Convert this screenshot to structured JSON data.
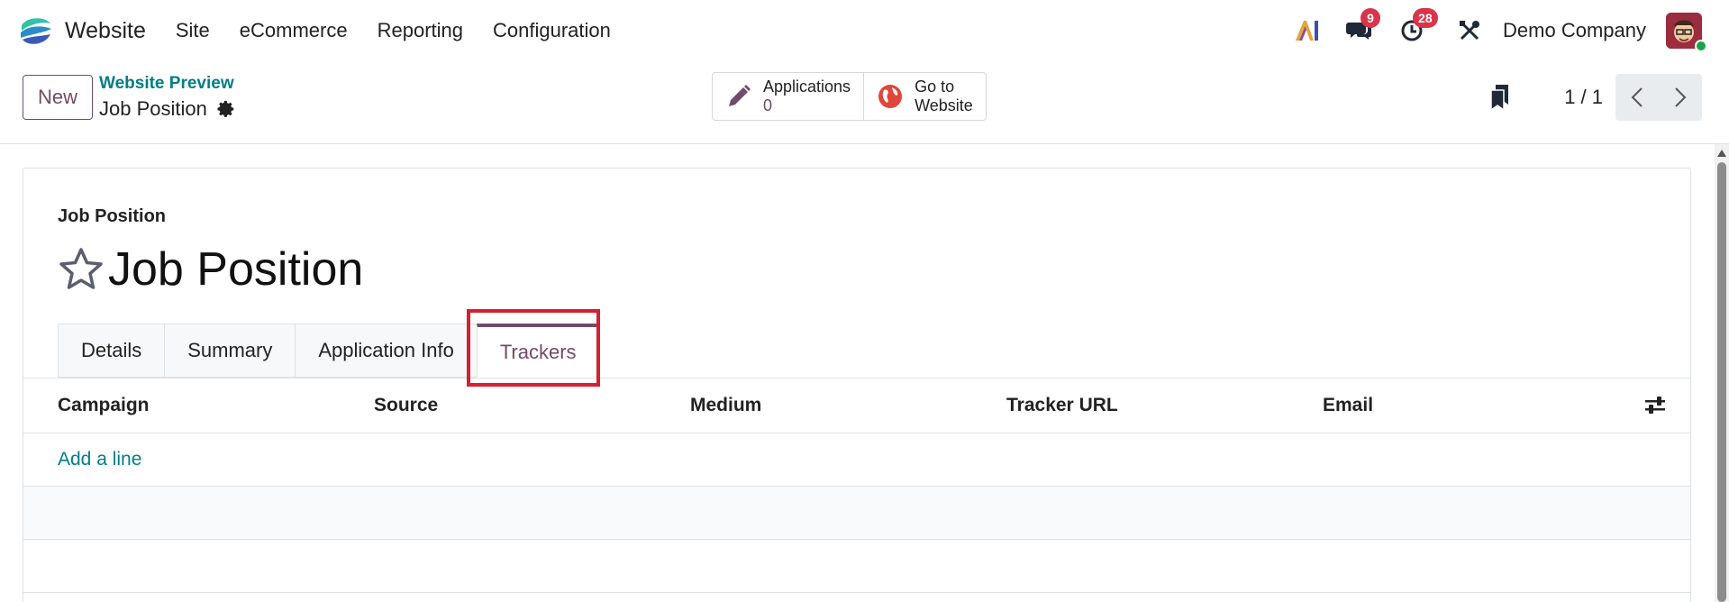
{
  "navbar": {
    "app_name": "Website",
    "menu": [
      "Site",
      "eCommerce",
      "Reporting",
      "Configuration"
    ],
    "messages_count": "9",
    "activities_count": "28",
    "company": "Demo Company"
  },
  "control": {
    "new_label": "New",
    "breadcrumb_parent": "Website Preview",
    "breadcrumb_current": "Job Position",
    "smart_buttons": {
      "applications_label": "Applications",
      "applications_value": "0",
      "go_to_line1": "Go to",
      "go_to_line2": "Website"
    },
    "pager": "1 / 1"
  },
  "form": {
    "field_label": "Job Position",
    "title": "Job Position",
    "tabs": [
      "Details",
      "Summary",
      "Application Info",
      "Trackers"
    ],
    "active_tab": "Trackers",
    "columns": [
      "Campaign",
      "Source",
      "Medium",
      "Tracker URL",
      "Email"
    ],
    "add_line": "Add a line"
  },
  "colors": {
    "brand": "#714b67",
    "link": "#017e84",
    "badge": "#d9344a",
    "highlight": "#d42030"
  },
  "icons": [
    "website-logo-icon",
    "ai-icon",
    "chat-icon",
    "clock-icon",
    "tools-icon",
    "gear-icon",
    "pencil-icon",
    "globe-icon",
    "bookmark-icon",
    "chevron-left-icon",
    "chevron-right-icon",
    "star-icon",
    "sliders-icon"
  ]
}
